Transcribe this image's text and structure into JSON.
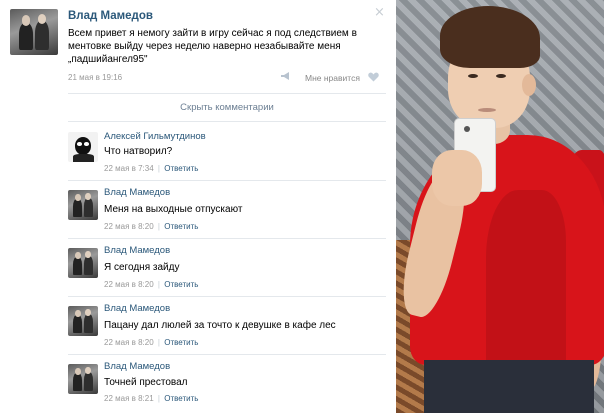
{
  "post": {
    "author": "Влад Мамедов",
    "text": "Всем привет я немогу зайти в игру сейчас я под следствием в ментовке выйду через неделю наверно незабывайте меня „падшийангел95\"",
    "date": "21 мая в 19:16",
    "like_label": "Мне нравится",
    "close_icon": "×"
  },
  "hide_comments_label": "Скрыть комментарии",
  "comments": [
    {
      "author": "Алексей Гильмутдинов",
      "text": "Что натворил?",
      "date": "22 мая в 7:34",
      "sep": "|",
      "reply": "Ответить"
    },
    {
      "author": "Влад Мамедов",
      "text": "Меня на выходные отпускают",
      "date": "22 мая в 8:20",
      "sep": "|",
      "reply": "Ответить"
    },
    {
      "author": "Влад Мамедов",
      "text": "Я сегодня зайду",
      "date": "22 мая в 8:20",
      "sep": "|",
      "reply": "Ответить"
    },
    {
      "author": "Влад Мамедов",
      "text": "Пацану дал люлей за точто к девушке в кафе лес",
      "date": "22 мая в 8:20",
      "sep": "|",
      "reply": "Ответить"
    },
    {
      "author": "Влад Мамедов",
      "text": "Точней престовал",
      "date": "22 мая в 8:21",
      "sep": "|",
      "reply": "Ответить"
    }
  ],
  "colors": {
    "link": "#2b587a",
    "meta": "#999999",
    "shirt": "#d8141a"
  },
  "icons": {
    "close": "close-icon",
    "share": "megaphone-icon",
    "like": "heart-icon"
  }
}
